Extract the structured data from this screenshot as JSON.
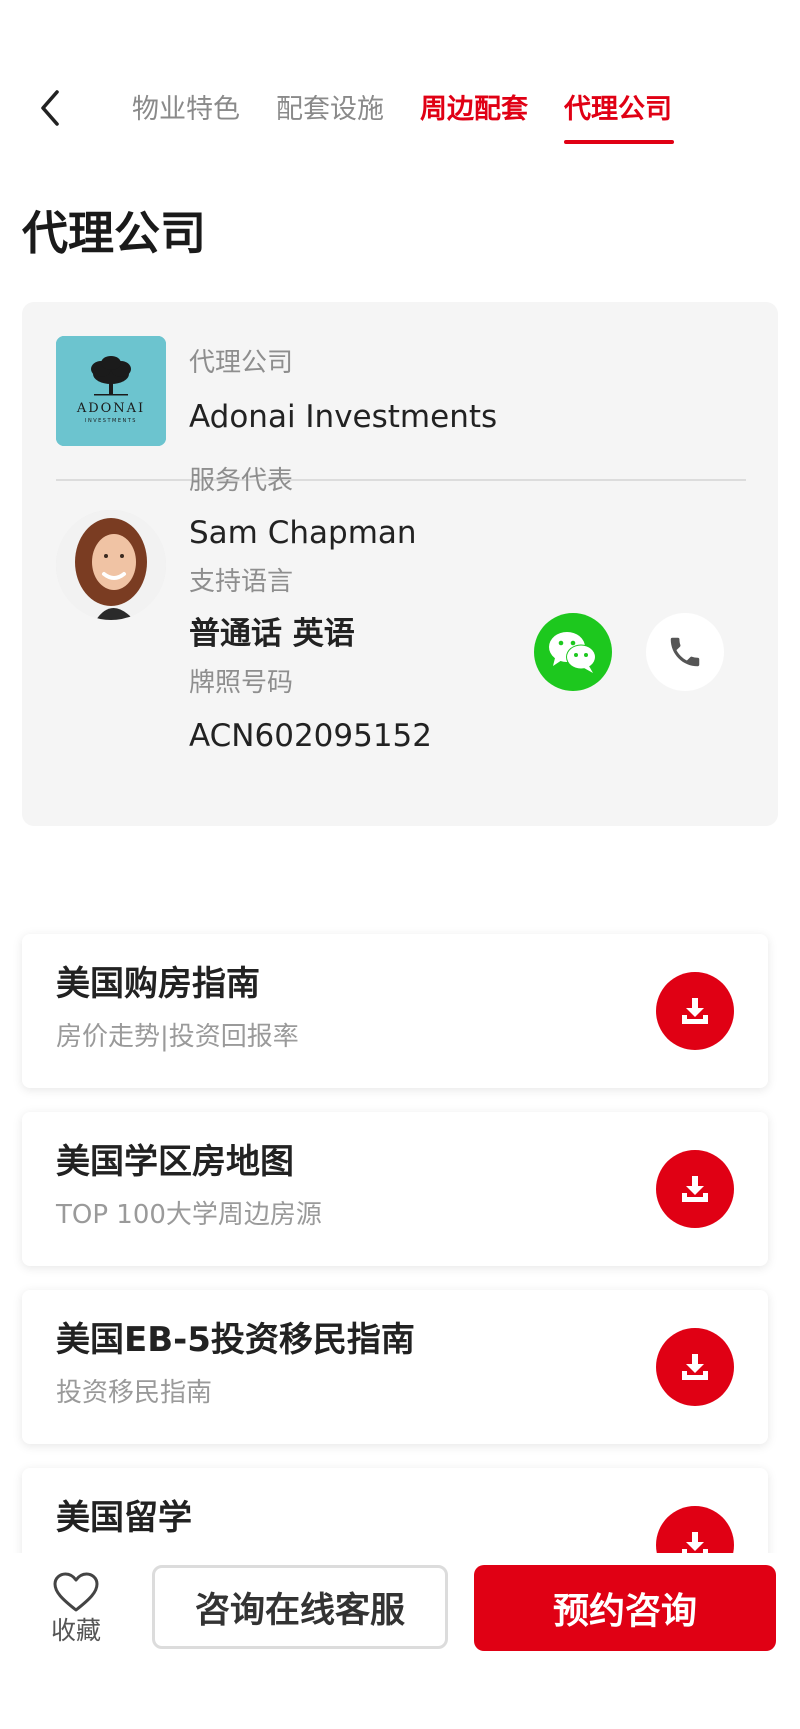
{
  "nav": {
    "tabs": [
      {
        "label": "物业特色"
      },
      {
        "label": "配套设施"
      },
      {
        "label": "周边配套"
      },
      {
        "label": "代理公司"
      }
    ],
    "active_tab": "代理公司"
  },
  "section": {
    "title": "代理公司"
  },
  "agency": {
    "company_label": "代理公司",
    "company_name": "Adonai Investments",
    "logo_text": "ADONAI",
    "logo_subtext": "INVESTMENTS",
    "rep_label": "服务代表",
    "rep_name": "Sam Chapman",
    "language_label": "支持语言",
    "languages": "普通话 英语",
    "license_label": "牌照号码",
    "license_number": "ACN602095152"
  },
  "guides": [
    {
      "title": "美国购房指南",
      "subtitle": "房价走势|投资回报率"
    },
    {
      "title": "美国学区房地图",
      "subtitle": "TOP 100大学周边房源"
    },
    {
      "title": "美国EB-5投资移民指南",
      "subtitle": "投资移民指南"
    },
    {
      "title": "美国留学",
      "subtitle": ""
    }
  ],
  "bottom_bar": {
    "favorite_label": "收藏",
    "consult_online_label": "咨询在线客服",
    "book_label": "预约咨询"
  },
  "colors": {
    "accent": "#e00014",
    "wechat": "#1dc81e",
    "logo_bg": "#6cc4cf",
    "card_bg": "#f5f5f5"
  }
}
